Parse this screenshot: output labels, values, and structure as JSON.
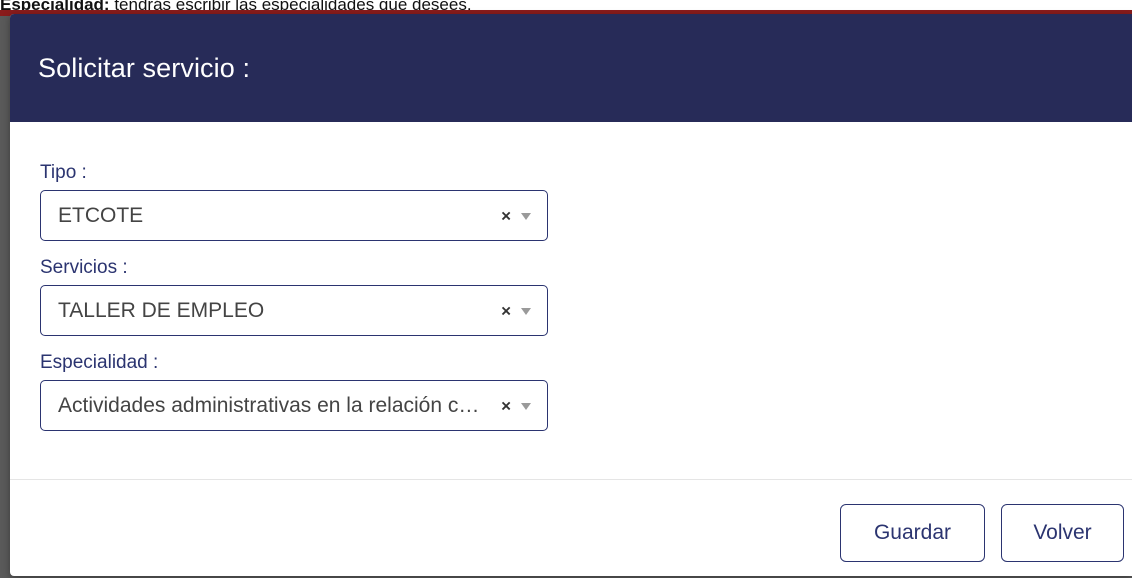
{
  "background": {
    "label_bold": "Especialidad:",
    "text": " tendrás escribir las especialidades que desees."
  },
  "modal": {
    "title": "Solicitar servicio :",
    "fields": [
      {
        "label": "Tipo :",
        "value": "ETCOTE"
      },
      {
        "label": "Servicios :",
        "value": "TALLER DE EMPLEO"
      },
      {
        "label": "Especialidad :",
        "value": "Actividades administrativas en la relación con el cliente"
      }
    ],
    "clear_glyph": "×",
    "buttons": {
      "save": "Guardar",
      "back": "Volver"
    }
  },
  "colors": {
    "header_bg": "#272b58",
    "accent": "#2b3470"
  },
  "icons": {
    "clear": "close-icon",
    "dropdown": "chevron-down-icon"
  }
}
